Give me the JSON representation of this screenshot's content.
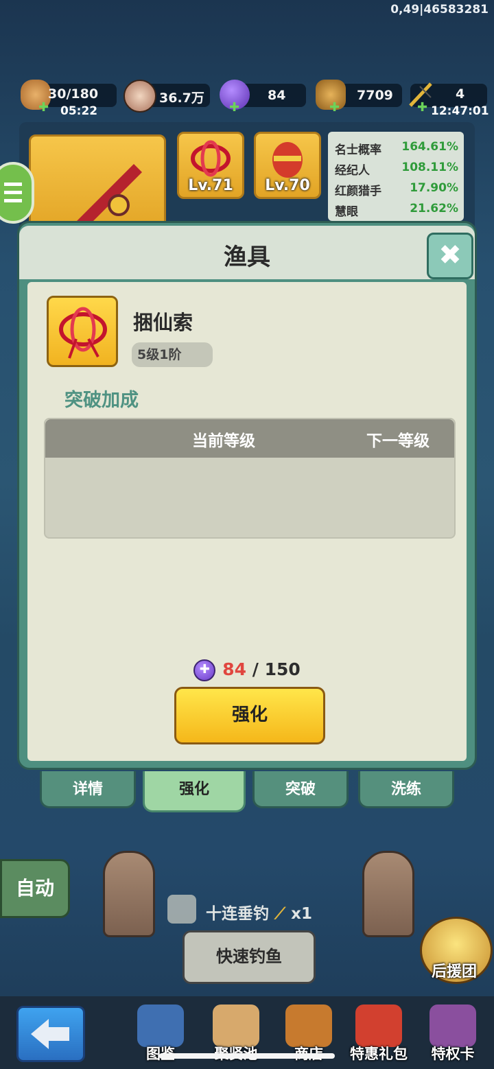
{
  "status": {
    "coord": "0,49|46583281"
  },
  "resources": [
    {
      "name": "stamina",
      "value": "30/180",
      "sub": "05:22"
    },
    {
      "name": "coins",
      "value": "36.7万"
    },
    {
      "name": "purple-gem",
      "value": "84"
    },
    {
      "name": "bronze-token",
      "value": "7709"
    },
    {
      "name": "fishing-rod-count",
      "value": "4",
      "sub": "12:47:01"
    }
  ],
  "equipment": {
    "slots": [
      {
        "level": "Lv.71"
      },
      {
        "level": "Lv.70"
      }
    ],
    "stats": [
      {
        "label": "名士概率",
        "value": "164.61%"
      },
      {
        "label": "经纪人",
        "value": "108.11%"
      },
      {
        "label": "红颜猎手",
        "value": "17.90%"
      },
      {
        "label": "慧眼",
        "value": "21.62%"
      }
    ]
  },
  "dialog": {
    "title": "渔具",
    "item_name": "捆仙索",
    "item_tier": "5级1阶",
    "section_title": "突破加成",
    "table_headers": {
      "current": "当前等级",
      "next": "下一等级"
    },
    "cost_have": "84",
    "cost_sep": " / ",
    "cost_need": "150",
    "enhance_label": "强化"
  },
  "tabs": [
    {
      "label": "详情",
      "active": false
    },
    {
      "label": "强化",
      "active": true
    },
    {
      "label": "突破",
      "active": false
    },
    {
      "label": "洗练",
      "active": false
    }
  ],
  "scene": {
    "auto_label": "自动",
    "ten_cast_label": "十连垂钓",
    "ten_cast_count": "x1",
    "fast_fish_label": "快速钓鱼",
    "support_label": "后援团"
  },
  "nav": [
    {
      "label": "图鉴"
    },
    {
      "label": "聚贤池"
    },
    {
      "label": "商店"
    },
    {
      "label": "特惠礼包"
    },
    {
      "label": "特权卡"
    }
  ]
}
